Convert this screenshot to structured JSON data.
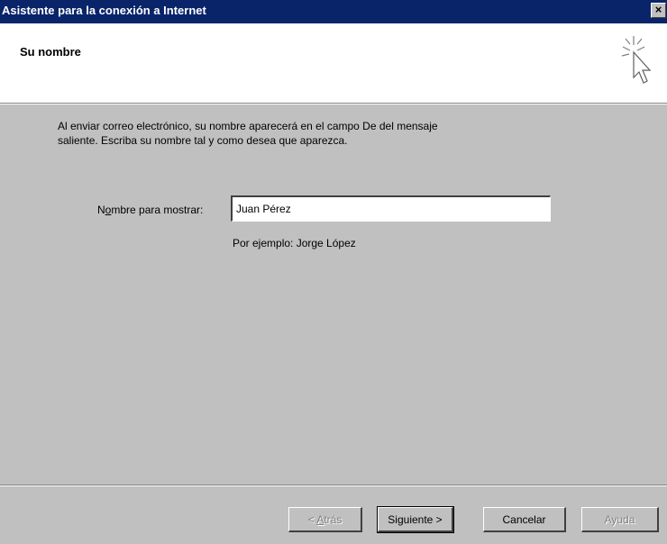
{
  "window": {
    "title": "Asistente para la conexión a Internet",
    "close_label": "×"
  },
  "header": {
    "title": "Su nombre",
    "icon": "wizard-cursor-icon"
  },
  "content": {
    "description_line1": "Al enviar correo electrónico, su nombre aparecerá en el campo De del mensaje",
    "description_line2": "saliente. Escriba su nombre tal y como desea que aparezca.",
    "field_label_pre": "N",
    "field_label_mnemonic": "o",
    "field_label_post": "mbre para mostrar:",
    "name_value": "Juan Pérez",
    "example_text": "Por ejemplo: Jorge López"
  },
  "buttons": {
    "back_pre": "< ",
    "back_mnemonic": "A",
    "back_post": "trás",
    "back_disabled": true,
    "next_label": "Siguiente >",
    "cancel_label": "Cancelar",
    "help_label": "Ayuda",
    "help_disabled": true
  },
  "colors": {
    "titlebar": "#0a246a",
    "face": "#c0c0c0",
    "header_bg": "#ffffff"
  }
}
